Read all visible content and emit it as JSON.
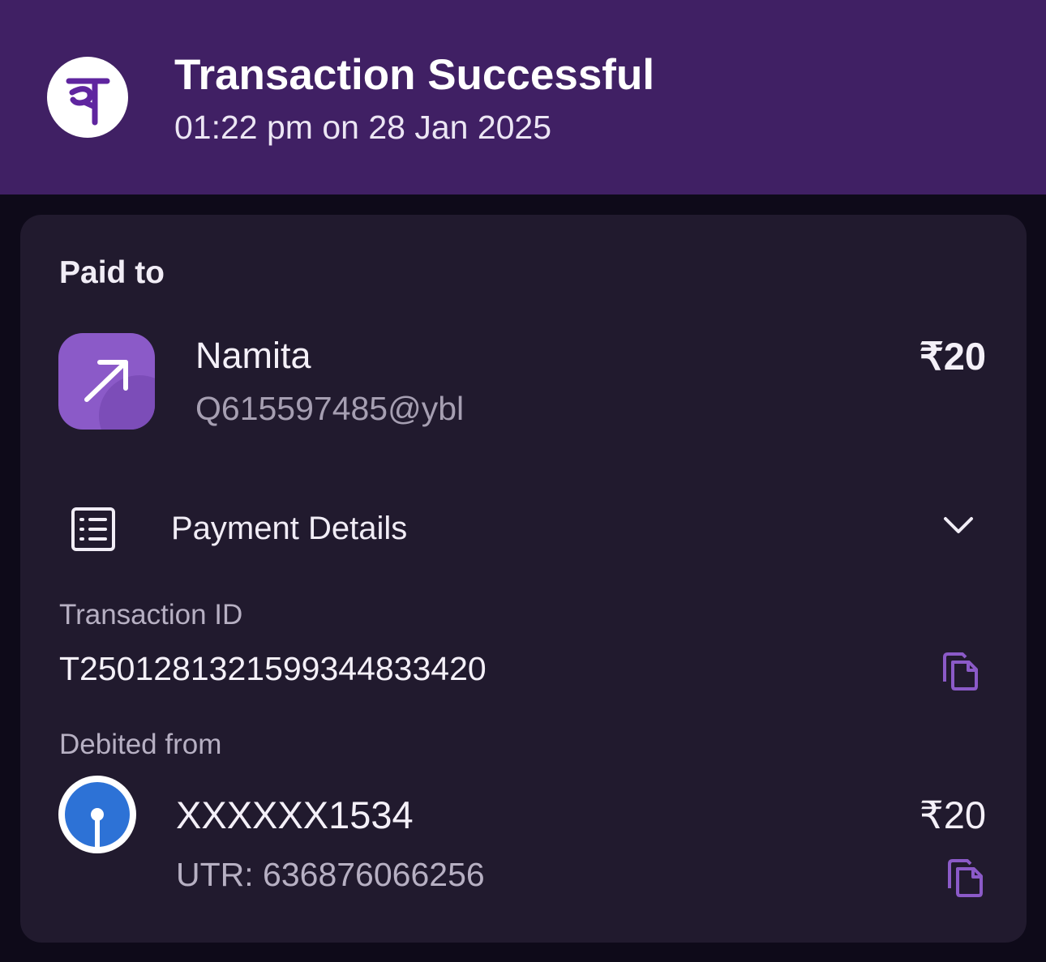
{
  "header": {
    "logo_text": "पे",
    "title": "Transaction Successful",
    "timestamp": "01:22 pm on 28 Jan 2025",
    "background": "#402064"
  },
  "paid_to": {
    "label": "Paid to",
    "icon": "arrow-up-right-icon",
    "name": "Namita",
    "upi_id": "Q615597485@ybl",
    "amount": "₹20"
  },
  "payment_details": {
    "label": "Payment Details",
    "icon": "receipt-list-icon",
    "toggle_icon": "chevron-down-icon",
    "transaction_id_label": "Transaction ID",
    "transaction_id": "T2501281321599344833420"
  },
  "debited_from": {
    "label": "Debited from",
    "bank_icon": "bank-logo-icon",
    "account": "XXXXXX1534",
    "utr": "UTR: 636876066256",
    "amount": "₹20"
  },
  "colors": {
    "accent": "#8b5ac8",
    "card_background": "#211a2e",
    "page_background": "#0e0a19"
  }
}
